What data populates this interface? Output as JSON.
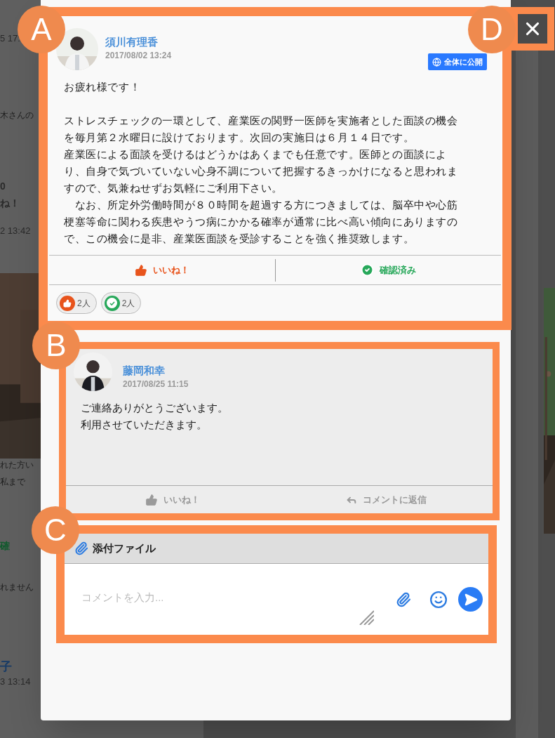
{
  "background": {
    "left_fragments": [
      {
        "kind": "time",
        "text": "5 17:"
      },
      {
        "kind": "body",
        "text": "木さんの"
      },
      {
        "kind": "count",
        "text": "0"
      },
      {
        "kind": "count",
        "text": "ね！"
      },
      {
        "kind": "time",
        "text": "2 13:42"
      },
      {
        "kind": "picture"
      },
      {
        "kind": "body",
        "text": "れた方い"
      },
      {
        "kind": "body",
        "text": "私まで"
      },
      {
        "kind": "confirm",
        "text": "確"
      },
      {
        "kind": "body",
        "text": "れません"
      },
      {
        "kind": "name",
        "text": "子"
      },
      {
        "kind": "time",
        "text": "3 13:14"
      }
    ]
  },
  "annotations": [
    {
      "label": "A"
    },
    {
      "label": "B"
    },
    {
      "label": "C"
    },
    {
      "label": "D"
    }
  ],
  "post": {
    "author": "須川有理香",
    "time": "2017/08/02 13:24",
    "visibility": "全体に公開",
    "greeting": "お疲れ様です！",
    "paragraphs": [
      "ストレスチェックの一環として、産業医の関野一医師を実施者とした面談の機会を毎月第２水曜日に設けております。次回の実施日は６月１４日です。",
      "産業医による面談を受けるはどうかはあくまでも任意です。医師との面談により、自身で気づいていない心身不調について把握するきっかけになると思われますので、気兼ねせずお気軽にご利用下さい。",
      "　なお、所定外労働時間が８０時間を超過する方につきましては、脳卒中や心筋梗塞等命に関わる疾患やうつ病にかかる確率が通常に比べ高い傾向にありますので、この機会に是非、産業医面談を受診することを強く推奨致します。"
    ],
    "actions": [
      {
        "kind": "like",
        "label": "いいね！",
        "selected": true
      },
      {
        "kind": "confirm",
        "label": "確認済み",
        "selected": true
      }
    ],
    "reactions": [
      {
        "kind": "like",
        "count": "2人"
      },
      {
        "kind": "confirm",
        "count": "2人"
      }
    ]
  },
  "comment": {
    "author": "藤岡和幸",
    "time": "2017/08/25 11:15",
    "lines": [
      "ご連絡ありがとうございます。",
      "利用させていただきます。"
    ],
    "actions": [
      {
        "kind": "like",
        "label": "いいね！",
        "selected": false
      },
      {
        "kind": "reply",
        "label": "コメントに返信"
      }
    ]
  },
  "composer": {
    "attachment_label": "添付ファイル",
    "placeholder": "コメントを入力..."
  }
}
